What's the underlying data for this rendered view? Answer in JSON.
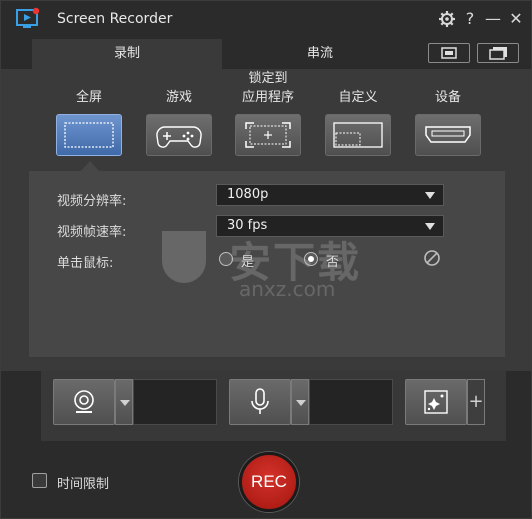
{
  "app": {
    "title": "Screen Recorder"
  },
  "titlebar": {
    "settings_icon": "gear-icon",
    "help": "?",
    "minimize": "—",
    "close": "✕"
  },
  "tabs": [
    {
      "label": "录制",
      "active": true
    },
    {
      "label": "串流",
      "active": false
    }
  ],
  "modes": [
    {
      "label": "全屏",
      "icon": "fullscreen-icon",
      "selected": true
    },
    {
      "label": "游戏",
      "icon": "gamepad-icon",
      "selected": false
    },
    {
      "label": "锁定到\n应用程序",
      "label_line1": "锁定到",
      "label_line2": "应用程序",
      "icon": "lock-to-app-icon",
      "selected": false
    },
    {
      "label": "自定义",
      "icon": "custom-region-icon",
      "selected": false
    },
    {
      "label": "设备",
      "icon": "hdmi-device-icon",
      "selected": false
    }
  ],
  "settings": {
    "resolution_label": "视频分辨率:",
    "resolution_value": "1080p",
    "framerate_label": "视频帧速率:",
    "framerate_value": "30 fps",
    "click_label": "单击鼠标:",
    "click_option_1": "是",
    "click_option_2": "否"
  },
  "watermark": {
    "text": "安下载",
    "sub": "anxz.com"
  },
  "bottom": {
    "webcam_icon": "webcam-icon",
    "mic_icon": "microphone-icon",
    "effects_icon": "sparkle-effects-icon",
    "add": "+"
  },
  "footer": {
    "time_limit_label": "时间限制",
    "time_limit_checked": false,
    "rec_label": "REC"
  },
  "colors": {
    "selected_mode": "#4f79b8",
    "rec_button": "#c0261e",
    "app_logo": "#3aa0e6"
  }
}
